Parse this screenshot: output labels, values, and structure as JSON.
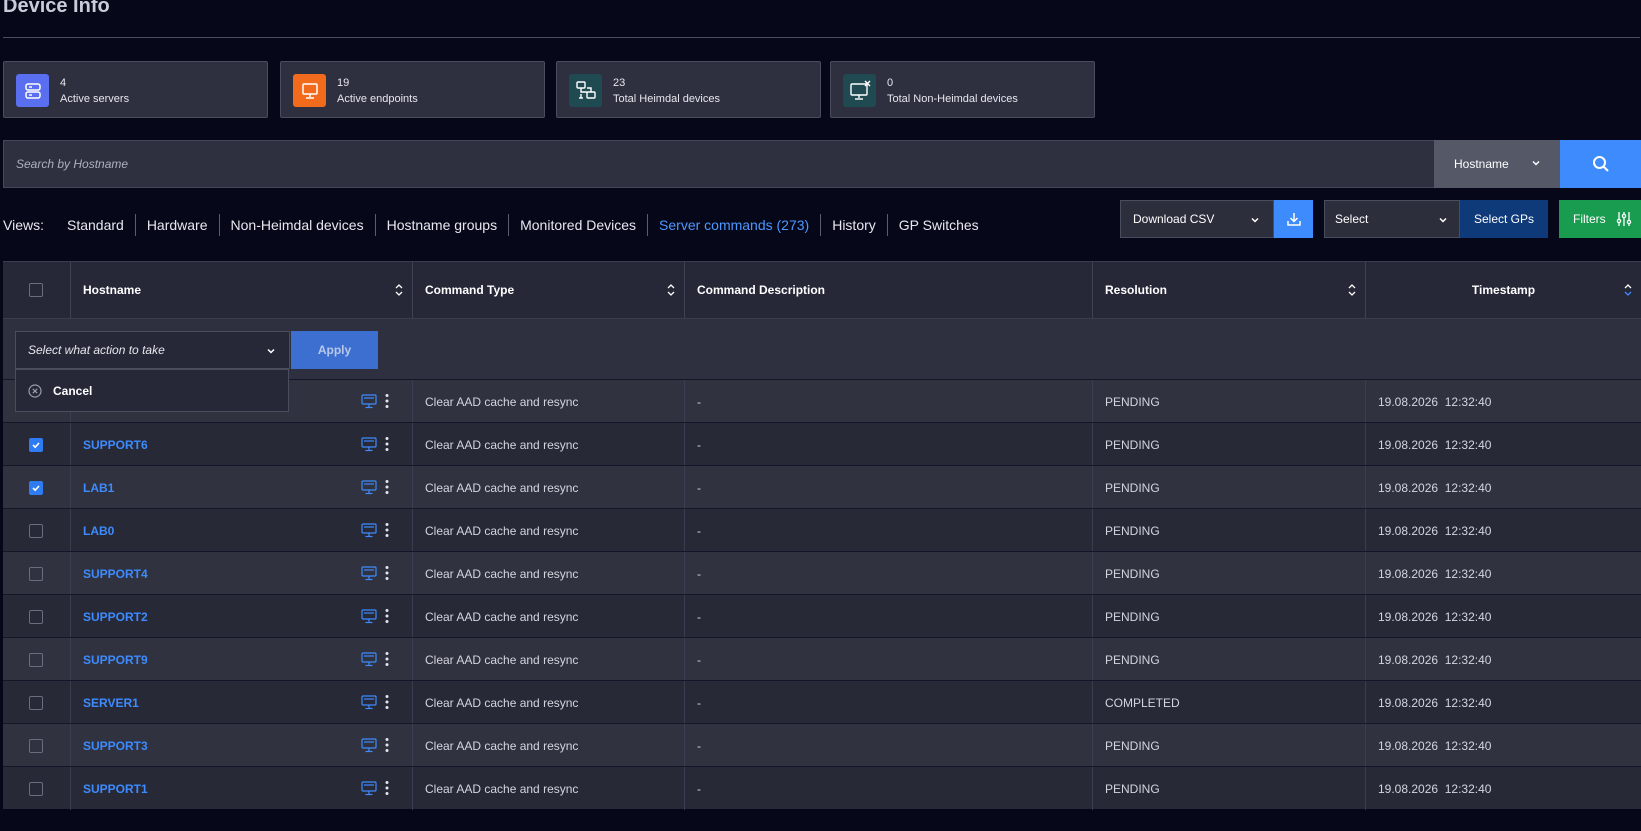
{
  "page": {
    "title": "Device Info"
  },
  "stats": [
    {
      "count": "4",
      "label": "Active servers",
      "icon": "servers-icon",
      "color": "#5a6ff0"
    },
    {
      "count": "19",
      "label": "Active endpoints",
      "icon": "desktop-icon",
      "color": "#f26a1b"
    },
    {
      "count": "23",
      "label": "Total Heimdal devices",
      "icon": "devices-network-icon",
      "color": "#1f4a52"
    },
    {
      "count": "0",
      "label": "Total Non-Heimdal devices",
      "icon": "desktop-x-icon",
      "color": "#1f4a52"
    }
  ],
  "search": {
    "placeholder": "Search by Hostname",
    "field": "Hostname"
  },
  "views": {
    "label": "Views:",
    "tabs": [
      "Standard",
      "Hardware",
      "Non-Heimdal devices",
      "Hostname groups",
      "Monitored Devices",
      "Server commands (273)",
      "History",
      "GP Switches"
    ],
    "active": "Server commands (273)"
  },
  "toolbar": {
    "download_csv": "Download CSV",
    "gp_select": "Select",
    "select_gps": "Select GPs",
    "filters": "Filters"
  },
  "table": {
    "columns": {
      "hostname": "Hostname",
      "command_type": "Command Type",
      "command_description": "Command Description",
      "resolution": "Resolution",
      "timestamp": "Timestamp"
    },
    "action_placeholder": "Select what action to take",
    "apply": "Apply",
    "cancel": "Cancel",
    "rows": [
      {
        "hostname": "",
        "checked": false,
        "command_type": "Clear AAD cache and resync",
        "description": "-",
        "resolution": "PENDING",
        "timestamp": "19.08.2026  12:32:40"
      },
      {
        "hostname": "SUPPORT6",
        "checked": true,
        "command_type": "Clear AAD cache and resync",
        "description": "-",
        "resolution": "PENDING",
        "timestamp": "19.08.2026  12:32:40"
      },
      {
        "hostname": "LAB1",
        "checked": true,
        "command_type": "Clear AAD cache and resync",
        "description": "-",
        "resolution": "PENDING",
        "timestamp": "19.08.2026  12:32:40"
      },
      {
        "hostname": "LAB0",
        "checked": false,
        "command_type": "Clear AAD cache and resync",
        "description": "-",
        "resolution": "PENDING",
        "timestamp": "19.08.2026  12:32:40"
      },
      {
        "hostname": "SUPPORT4",
        "checked": false,
        "command_type": "Clear AAD cache and resync",
        "description": "-",
        "resolution": "PENDING",
        "timestamp": "19.08.2026  12:32:40"
      },
      {
        "hostname": "SUPPORT2",
        "checked": false,
        "command_type": "Clear AAD cache and resync",
        "description": "-",
        "resolution": "PENDING",
        "timestamp": "19.08.2026  12:32:40"
      },
      {
        "hostname": "SUPPORT9",
        "checked": false,
        "command_type": "Clear AAD cache and resync",
        "description": "-",
        "resolution": "PENDING",
        "timestamp": "19.08.2026  12:32:40"
      },
      {
        "hostname": "SERVER1",
        "checked": false,
        "command_type": "Clear AAD cache and resync",
        "description": "-",
        "resolution": "COMPLETED",
        "timestamp": "19.08.2026  12:32:40"
      },
      {
        "hostname": "SUPPORT3",
        "checked": false,
        "command_type": "Clear AAD cache and resync",
        "description": "-",
        "resolution": "PENDING",
        "timestamp": "19.08.2026  12:32:40"
      },
      {
        "hostname": "SUPPORT1",
        "checked": false,
        "command_type": "Clear AAD cache and resync",
        "description": "-",
        "resolution": "PENDING",
        "timestamp": "19.08.2026  12:32:40"
      }
    ]
  }
}
